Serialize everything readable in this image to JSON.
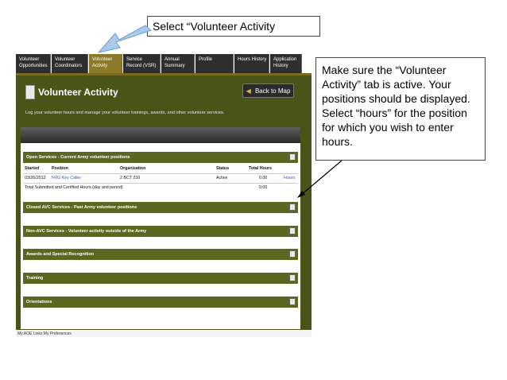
{
  "callouts": {
    "top": "Select “Volunteer Activity",
    "right": "Make sure the “Volunteer Activity” tab is active.  Your positions should be displayed.  Select “hours” for the position for which you wish to enter hours."
  },
  "tabs": [
    {
      "line1": "Volunteer",
      "line2": "Opportunities"
    },
    {
      "line1": "Volunteer",
      "line2": "Coordinators"
    },
    {
      "line1": "Volunteer",
      "line2": "Activity"
    },
    {
      "line1": "Service",
      "line2": "Record (VSR)"
    },
    {
      "line1": "Annual",
      "line2": "Summary"
    },
    {
      "line1": "Profile",
      "line2": ""
    },
    {
      "line1": "Hours History",
      "line2": ""
    },
    {
      "line1": "Application",
      "line2": "History"
    }
  ],
  "panel": {
    "title": "Volunteer Activity",
    "back_button": "Back to Map",
    "intro": "Log your volunteer hours and manage your volunteer trainings, awards, and other volunteer services."
  },
  "sections": {
    "open": "Open Services - Current Army volunteer positions",
    "closed": "Closed AVC Services - Past Army volunteer positions",
    "non_avc": "Non-AVC Services - Volunteer activity outside of the Army",
    "awards": "Awards and Special Recognition",
    "training": "Training",
    "orientations": "Orientations"
  },
  "table": {
    "headers": {
      "started": "Started",
      "position": "Position",
      "organization": "Organization",
      "status": "Status",
      "total_hours": "Total Hours"
    },
    "row": {
      "started": "03/26/2012",
      "position": "FRG Key Caller",
      "organization": "2 BCT 210",
      "status": "Active",
      "total_hours": "0.00",
      "action": "Hours"
    },
    "total": {
      "label": "Total Submitted and Certified Hours (day and period)",
      "value": "0.00"
    }
  },
  "bottom_strip": "My AOE Links   My Preferences"
}
